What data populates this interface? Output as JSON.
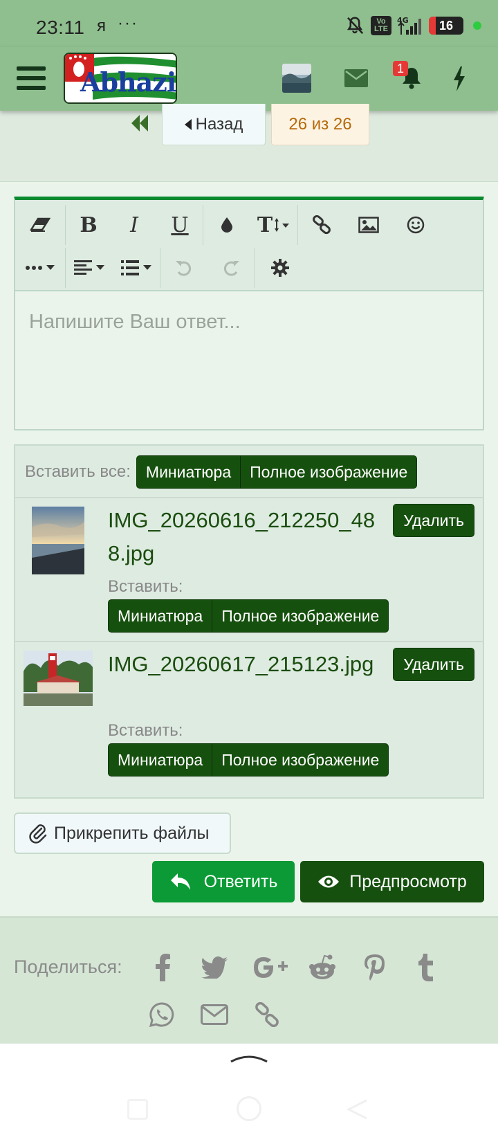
{
  "status_bar": {
    "time": "23:11",
    "carrier_glyph": "я",
    "more_glyph": "···",
    "volte_line1": "Vo",
    "volte_line2": "LTE",
    "network": "4G",
    "battery": "16"
  },
  "header": {
    "logo_text": "Abhazia",
    "notifications_count": "1"
  },
  "pager": {
    "back_label": "Назад",
    "page_status": "26 из 26"
  },
  "editor": {
    "placeholder": "Напишите Ваш ответ...",
    "toolbar_row1": [
      "eraser-icon",
      "bold",
      "italic",
      "underline",
      "color-drop-icon",
      "font-size-icon",
      "link-icon",
      "image-icon",
      "smiley-icon"
    ],
    "toolbar_row2": [
      "more-icon",
      "align-icon",
      "list-icon",
      "undo-icon",
      "redo-icon",
      "gear-icon"
    ],
    "bold_glyph": "B",
    "italic_glyph": "I",
    "underline_glyph": "U",
    "font_size_glyph": "T"
  },
  "attachments": {
    "insert_all_label": "Вставить все:",
    "thumbnail_label": "Миниатюра",
    "full_image_label": "Полное изображение",
    "insert_label": "Вставить:",
    "delete_label": "Удалить",
    "items": [
      {
        "filename": "IMG_20260616_212250_488.jpg"
      },
      {
        "filename": "IMG_20260617_215123.jpg"
      }
    ]
  },
  "actions": {
    "attach_files": "Прикрепить файлы",
    "reply": "Ответить",
    "preview": "Предпросмотр"
  },
  "footer": {
    "share_label": "Поделиться:",
    "share_icons": [
      "facebook-icon",
      "twitter-icon",
      "google-plus-icon",
      "reddit-icon",
      "pinterest-icon",
      "tumblr-icon",
      "whatsapp-icon",
      "email-icon",
      "link-icon"
    ]
  },
  "colors": {
    "header_green": "#8fbf8f",
    "button_dark_green": "#16500e",
    "reply_green": "#0b9a35",
    "editor_accent": "#0a8a2e",
    "count_orange": "#b66a0a"
  }
}
